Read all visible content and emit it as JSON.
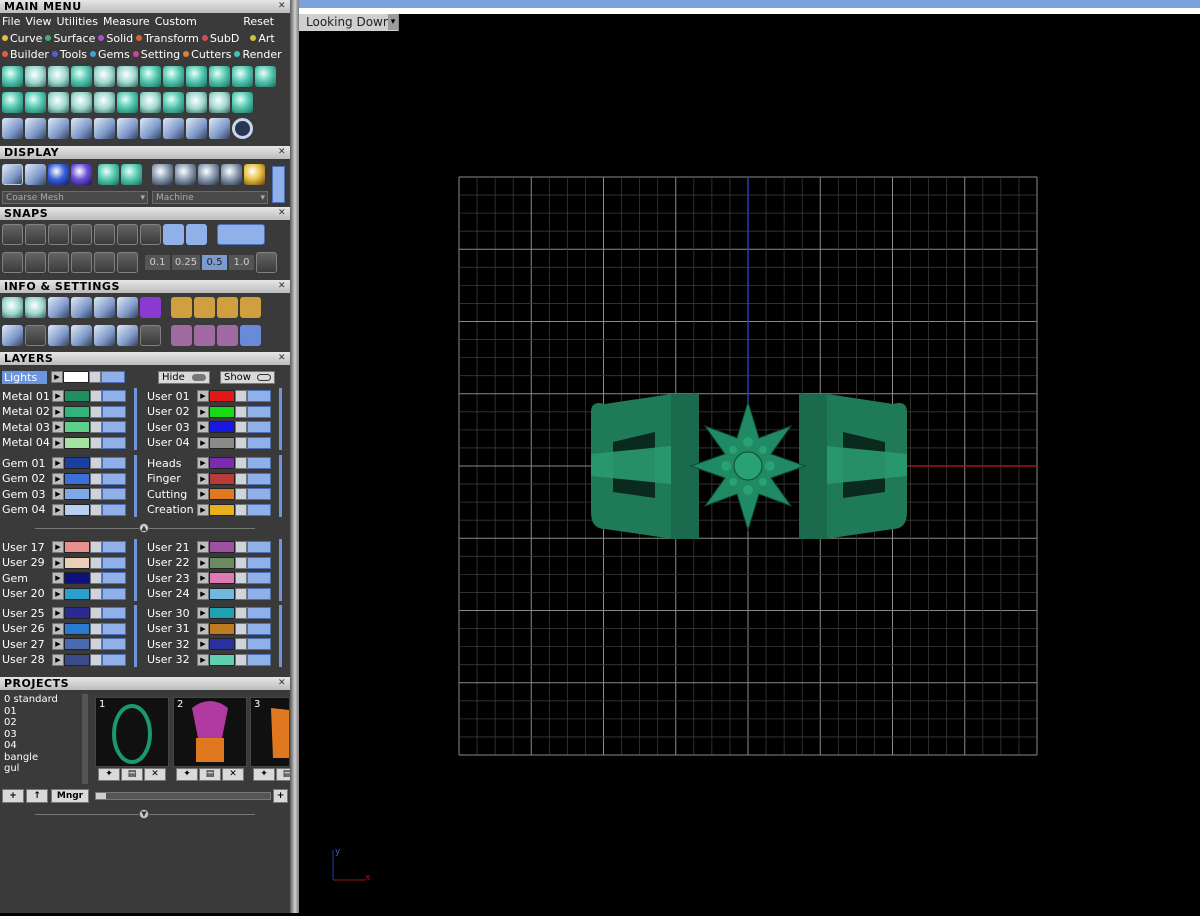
{
  "main_menu": {
    "title": "MAIN MENU",
    "menus": [
      "File",
      "View",
      "Utilities",
      "Measure",
      "Custom"
    ],
    "reset_label": "Reset",
    "categories_row1": [
      {
        "label": "Curve",
        "color": "#e0c040"
      },
      {
        "label": "Surface",
        "color": "#40b070"
      },
      {
        "label": "Solid",
        "color": "#b050d0"
      },
      {
        "label": "Transform",
        "color": "#e06030"
      },
      {
        "label": "SubD",
        "color": "#d05050"
      },
      {
        "label": "Art",
        "color": "#d0c040"
      }
    ],
    "categories_row2": [
      {
        "label": "Builder",
        "color": "#e06040"
      },
      {
        "label": "Tools",
        "color": "#5060e0"
      },
      {
        "label": "Gems",
        "color": "#40a0d0"
      },
      {
        "label": "Setting",
        "color": "#d040a0"
      },
      {
        "label": "Cutters",
        "color": "#e08030"
      },
      {
        "label": "Render",
        "color": "#40c0c0"
      }
    ]
  },
  "display": {
    "title": "DISPLAY",
    "mode_dropdown": "Coarse Mesh",
    "material_dropdown": "Machine"
  },
  "snaps": {
    "title": "SNAPS",
    "values": [
      "0.1",
      "0.25",
      "0.5",
      "1.0"
    ]
  },
  "info": {
    "title": "INFO & SETTINGS"
  },
  "layers": {
    "title": "LAYERS",
    "lights_label": "Lights",
    "hide_label": "Hide",
    "show_label": "Show",
    "group1_left": [
      {
        "name": "Metal 01",
        "color": "#1f8f5f"
      },
      {
        "name": "Metal 02",
        "color": "#2fb57a"
      },
      {
        "name": "Metal 03",
        "color": "#5fd08a"
      },
      {
        "name": "Metal 04",
        "color": "#a4e3a0"
      }
    ],
    "group1_right": [
      {
        "name": "User 01",
        "color": "#e01818"
      },
      {
        "name": "User 02",
        "color": "#18d818"
      },
      {
        "name": "User 03",
        "color": "#1818e0"
      },
      {
        "name": "User 04",
        "color": "#8a8a8a"
      }
    ],
    "group2_left": [
      {
        "name": "Gem 01",
        "color": "#1a3fa0"
      },
      {
        "name": "Gem 02",
        "color": "#3d6fd8"
      },
      {
        "name": "Gem 03",
        "color": "#7ea8e6"
      },
      {
        "name": "Gem 04",
        "color": "#b7d0f2"
      }
    ],
    "group2_right": [
      {
        "name": "Heads",
        "color": "#7a2bb0"
      },
      {
        "name": "Finger",
        "color": "#b83a3a"
      },
      {
        "name": "Cutting",
        "color": "#e07820"
      },
      {
        "name": "Creation",
        "color": "#e8b020"
      }
    ],
    "group3_left": [
      {
        "name": "User 17",
        "color": "#e89090"
      },
      {
        "name": "User 29",
        "color": "#e8d0b8"
      },
      {
        "name": "Gem",
        "color": "#10107a"
      },
      {
        "name": "User 20",
        "color": "#2aa0d0"
      }
    ],
    "group3_right": [
      {
        "name": "User 21",
        "color": "#a050a0"
      },
      {
        "name": "User 22",
        "color": "#6a8a60"
      },
      {
        "name": "User 23",
        "color": "#e07ab0"
      },
      {
        "name": "User 24",
        "color": "#70b8e0"
      }
    ],
    "group4_left": [
      {
        "name": "User 25",
        "color": "#2a2a90"
      },
      {
        "name": "User 26",
        "color": "#2a7ad0"
      },
      {
        "name": "User 27",
        "color": "#4a6ab0"
      },
      {
        "name": "User 28",
        "color": "#3a4a8a"
      }
    ],
    "group4_right": [
      {
        "name": "User 30",
        "color": "#20a0b0"
      },
      {
        "name": "User 31",
        "color": "#c07a20"
      },
      {
        "name": "User 32",
        "color": "#2a30a0"
      },
      {
        "name": "User 32",
        "color": "#60d0b0"
      }
    ]
  },
  "projects": {
    "title": "PROJECTS",
    "items": [
      "0 standard",
      "01",
      "02",
      "03",
      "04",
      "bangle",
      "gul"
    ],
    "thumbs": [
      "1",
      "2",
      "3"
    ],
    "mngr_label": "Mngr"
  },
  "viewport": {
    "view_name": "Looking Down",
    "axis_x": "x",
    "axis_y": "y",
    "model_color": "#1e8a63"
  }
}
